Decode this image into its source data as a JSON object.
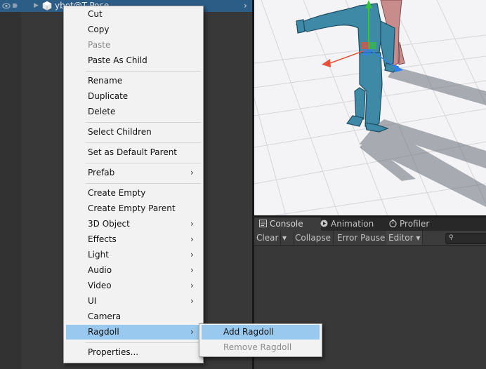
{
  "hierarchy": {
    "selected_item_name": "ybot@T-Pose"
  },
  "scene": {
    "background_color": "#f4f4f6",
    "model_color": "#3e8aa6"
  },
  "console": {
    "tabs": [
      {
        "label": "Console",
        "icon": "console-icon"
      },
      {
        "label": "Animation",
        "icon": "animation-icon"
      },
      {
        "label": "Profiler",
        "icon": "profiler-icon"
      }
    ],
    "toolbar": {
      "clear": "Clear",
      "collapse": "Collapse",
      "error_pause": "Error Pause",
      "editor": "Editor"
    }
  },
  "context_menu": {
    "items": [
      {
        "label": "Cut"
      },
      {
        "label": "Copy"
      },
      {
        "label": "Paste",
        "disabled": true
      },
      {
        "label": "Paste As Child"
      },
      {
        "label": "Rename"
      },
      {
        "label": "Duplicate"
      },
      {
        "label": "Delete"
      },
      {
        "label": "Select Children"
      },
      {
        "label": "Set as Default Parent"
      },
      {
        "label": "Prefab",
        "submenu": true
      },
      {
        "label": "Create Empty"
      },
      {
        "label": "Create Empty Parent"
      },
      {
        "label": "3D Object",
        "submenu": true
      },
      {
        "label": "Effects",
        "submenu": true
      },
      {
        "label": "Light",
        "submenu": true
      },
      {
        "label": "Audio",
        "submenu": true
      },
      {
        "label": "Video",
        "submenu": true
      },
      {
        "label": "UI",
        "submenu": true
      },
      {
        "label": "Camera"
      },
      {
        "label": "Ragdoll",
        "submenu": true,
        "highlighted": true
      },
      {
        "label": "Properties..."
      }
    ],
    "submenu_arrow": "›"
  },
  "ragdoll_submenu": {
    "items": [
      {
        "label": "Add Ragdoll",
        "highlighted": true
      },
      {
        "label": "Remove Ragdoll",
        "disabled": true
      }
    ]
  },
  "colors": {
    "highlight": "#99c9ef",
    "selection_row": "#2c5d87",
    "axis_y": "#36c43c",
    "axis_x": "#e8513a",
    "axis_z": "#2f7ff0"
  }
}
